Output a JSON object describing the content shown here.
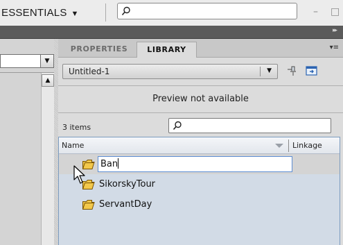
{
  "workspace": {
    "label": "ESSENTIALS",
    "arrow": "▼"
  },
  "window_controls": {
    "minimize": "–",
    "maximize": "□"
  },
  "strip": {
    "collapse_glyph": "▸▸"
  },
  "left_panel": {
    "dropdown_arrow": "▼",
    "scroll_up_arrow": "▲"
  },
  "library_panel": {
    "tabs": [
      {
        "label": "PROPERTIES",
        "active": false
      },
      {
        "label": "LIBRARY",
        "active": true
      }
    ],
    "menu_glyph": "▾≡",
    "document_select": {
      "value": "Untitled-1",
      "arrow": "▼"
    },
    "preview_text": "Preview not available",
    "item_count": "3 items",
    "search_placeholder": "",
    "columns": {
      "name": "Name",
      "linkage": "Linkage"
    },
    "items": [
      {
        "type": "folder",
        "name": "Ban",
        "editing": true
      },
      {
        "type": "folder",
        "name": "SikorskyTour",
        "editing": false
      },
      {
        "type": "folder",
        "name": "ServantDay",
        "editing": false
      }
    ]
  },
  "colors": {
    "list_background": "#d2dbe6",
    "list_border": "#7b9bbf",
    "folder_fill": "#f2c84b",
    "folder_outline": "#7a5400",
    "rename_border": "#5c8dd3",
    "dark_strip": "#5b5b5b"
  }
}
